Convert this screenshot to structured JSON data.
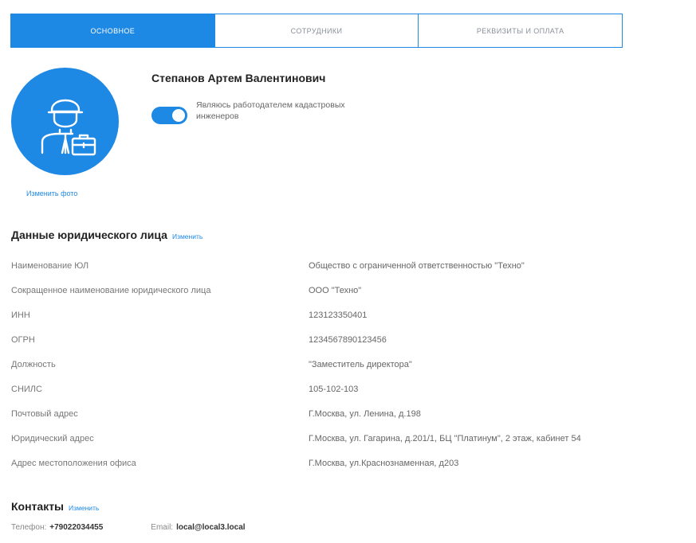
{
  "tabs": [
    {
      "label": "Основное",
      "active": true
    },
    {
      "label": "Сотрудники",
      "active": false
    },
    {
      "label": "Реквизиты и оплата",
      "active": false
    }
  ],
  "profile": {
    "name": "Степанов Артем Валентинович",
    "change_photo": "Изменить фото",
    "toggle_label": "Являюсь работодателем кадастровых инженеров",
    "toggle_on": true,
    "avatar_icon": "employee-briefcase-icon"
  },
  "legal": {
    "title": "Данные юридического лица",
    "edit": "Изменить",
    "rows": [
      {
        "label": "Наименование ЮЛ",
        "value": "Общество с ограниченной ответственностью \"Техно\""
      },
      {
        "label": "Сокращенное наименование юридического лица",
        "value": "ООО \"Техно\""
      },
      {
        "label": "ИНН",
        "value": "123123350401"
      },
      {
        "label": "ОГРН",
        "value": "1234567890123456"
      },
      {
        "label": "Должность",
        "value": "\"Заместитель директора\""
      },
      {
        "label": "СНИЛС",
        "value": "105-102-103"
      },
      {
        "label": "Почтовый адрес",
        "value": "Г.Москва, ул. Ленина, д.198"
      },
      {
        "label": "Юридический адрес",
        "value": "Г.Москва, ул. Гагарина, д.201/1, БЦ \"Платинум\", 2 этаж, кабинет 54"
      },
      {
        "label": "Адрес местоположения офиса",
        "value": "Г.Москва, ул.Краснознаменная, д203"
      }
    ]
  },
  "contacts": {
    "title": "Контакты",
    "edit": "Изменить",
    "phone_label": "Телефон:",
    "phone": "+79022034455",
    "email_label": "Email:",
    "email": "local@local3.local"
  },
  "colors": {
    "accent": "#1e88e5"
  }
}
